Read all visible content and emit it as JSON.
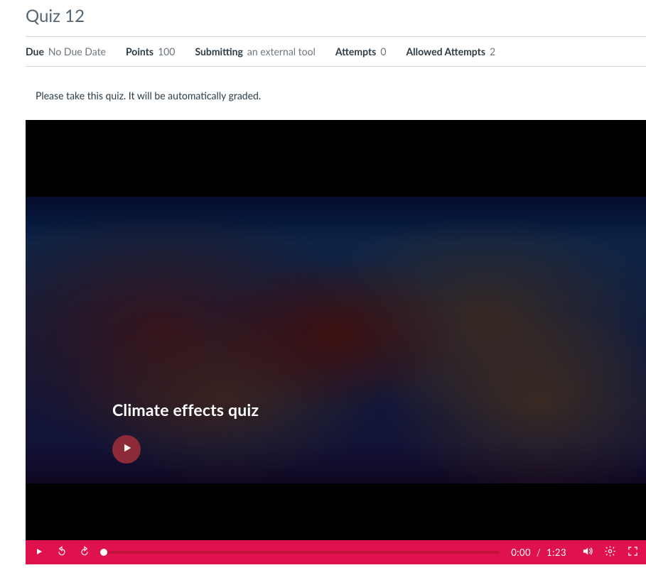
{
  "page": {
    "title": "Quiz 12",
    "instructions": "Please take this quiz. It will be automatically graded."
  },
  "meta": {
    "due_label": "Due",
    "due_value": "No Due Date",
    "points_label": "Points",
    "points_value": "100",
    "submitting_label": "Submitting",
    "submitting_value": "an external tool",
    "attempts_label": "Attempts",
    "attempts_value": "0",
    "allowed_label": "Allowed Attempts",
    "allowed_value": "2"
  },
  "video": {
    "title": "Climate effects quiz",
    "current_time": "0:00",
    "time_separator": "/",
    "duration": "1:23"
  },
  "icons": {
    "play": "play-icon",
    "rewind": "rewind-icon",
    "forward": "forward-icon",
    "volume": "volume-icon",
    "settings": "settings-icon",
    "fullscreen": "fullscreen-icon"
  },
  "colors": {
    "accent": "#e0124e"
  }
}
